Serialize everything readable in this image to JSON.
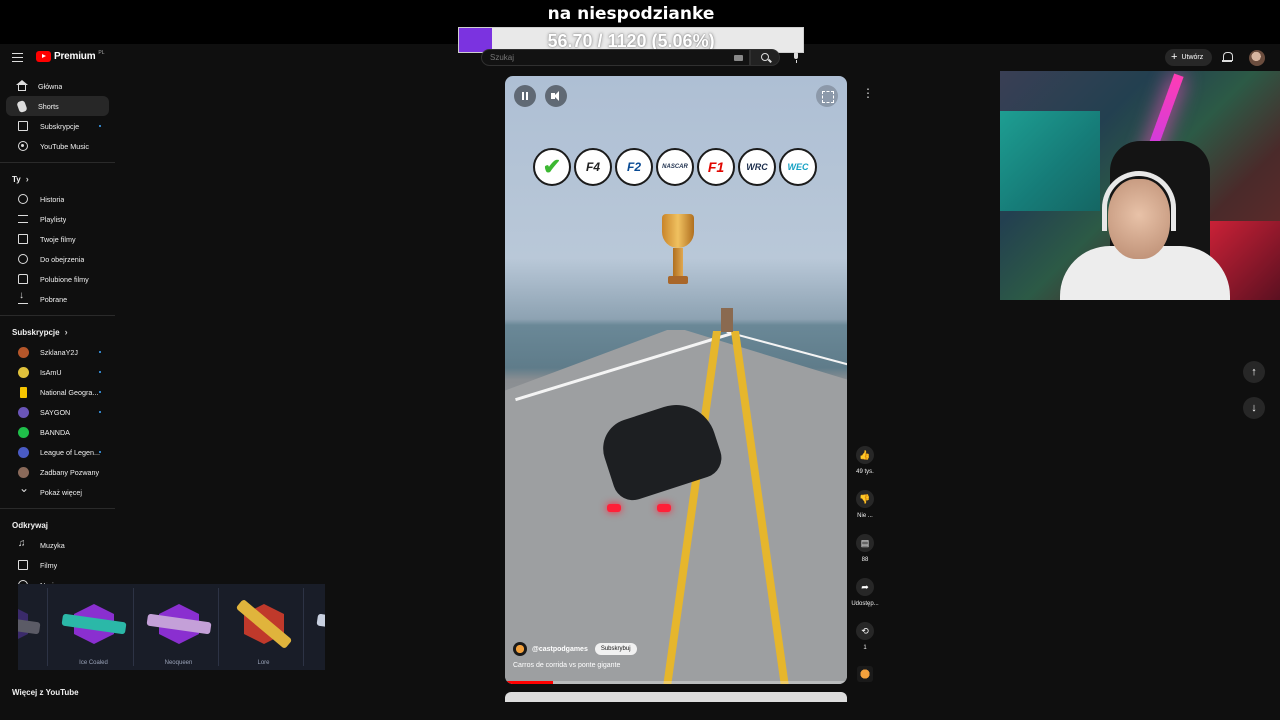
{
  "stream_overlay": {
    "goal_title": "na niespodzianke",
    "goal_text": "56.70 / 1120 (5.06%)",
    "goal_fraction": 0.0506,
    "goal_color": "#7b33e0"
  },
  "header": {
    "logo_text": "Premium",
    "logo_region": "PL",
    "search_placeholder": "Szukaj",
    "create_label": "Utwórz",
    "icons": [
      "menu-icon",
      "youtube-logo-icon",
      "keyboard-icon",
      "search-icon",
      "mic-icon",
      "plus-icon",
      "bell-icon",
      "avatar"
    ]
  },
  "sidebar": {
    "main": [
      {
        "label": "Główna",
        "icon": "home-icon"
      },
      {
        "label": "Shorts",
        "icon": "shorts-icon",
        "active": true
      },
      {
        "label": "Subskrypcje",
        "icon": "subscriptions-icon",
        "dot": true
      },
      {
        "label": "YouTube Music",
        "icon": "music-icon"
      }
    ],
    "you_title": "Ty",
    "you": [
      {
        "label": "Historia",
        "icon": "history-icon"
      },
      {
        "label": "Playlisty",
        "icon": "playlist-icon"
      },
      {
        "label": "Twoje filmy",
        "icon": "video-icon"
      },
      {
        "label": "Do obejrzenia",
        "icon": "clock-icon"
      },
      {
        "label": "Polubione filmy",
        "icon": "like-icon"
      },
      {
        "label": "Pobrane",
        "icon": "download-icon"
      }
    ],
    "subs_title": "Subskrypcje",
    "subs": [
      {
        "label": "SzklanaY2J",
        "color": "#b5562a",
        "dot": true
      },
      {
        "label": "IsAmU",
        "color": "#e0c23c",
        "dot": true
      },
      {
        "label": "National Geogra...",
        "color": "#f5c400",
        "dot": true
      },
      {
        "label": "SAYGON",
        "color": "#6a55b8",
        "dot": true
      },
      {
        "label": "BANNDA",
        "color": "#1fbf4a"
      },
      {
        "label": "League of Legen...",
        "color": "#4a5bc4",
        "dot": true
      },
      {
        "label": "Zadbany Pozwany",
        "color": "#8a6a5a"
      }
    ],
    "show_more": "Pokaż więcej",
    "explore_title": "Odkrywaj",
    "explore": [
      {
        "label": "Muzyka",
        "icon": "music-note-icon"
      },
      {
        "label": "Filmy",
        "icon": "film-icon"
      },
      {
        "label": "Na żywo",
        "icon": "live-icon"
      }
    ],
    "more_title": "Więcej z YouTube"
  },
  "weapon_strip": {
    "items": [
      {
        "label": "",
        "hex": "#3a2a6a",
        "gun": "#5b5b66"
      },
      {
        "label": "Ice Coaled",
        "hex": "#8a2fd0",
        "gun": "#2bb8a8"
      },
      {
        "label": "Neoqueen",
        "hex": "#8a2fd0",
        "gun": "#c4a0d8"
      },
      {
        "label": "Lore",
        "hex": "#c0392b",
        "gun": "#e0b43c"
      },
      {
        "label": "",
        "hex": "#2a3a6a",
        "gun": "#c8d0e0"
      }
    ]
  },
  "short": {
    "badges": [
      "✔",
      "F4",
      "F2",
      "NASCAR",
      "F1",
      "WRC",
      "WEC"
    ],
    "channel": "@castpodgames",
    "subscribe_label": "Subskrybuj",
    "title": "Carros de corrida vs ponte gigante",
    "progress": 0.14
  },
  "actions": {
    "like_count": "49 tys.",
    "dislike_label": "Nie ...",
    "comments_count": "88",
    "share_label": "Udostęp...",
    "remix_count": "1"
  },
  "colors": {
    "background": "#0f0f0f",
    "accent": "#ff0000",
    "active_item": "#272727"
  }
}
